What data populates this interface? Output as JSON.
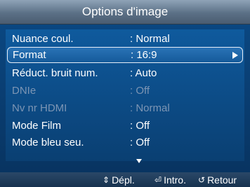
{
  "title": "Options d'image",
  "menu": {
    "items": [
      {
        "label": "Nuance coul.",
        "value": ": Normal",
        "state": "normal"
      },
      {
        "label": "Format",
        "value": ": 16:9",
        "state": "selected"
      },
      {
        "label": "Réduct. bruit num.",
        "value": ": Auto",
        "state": "normal"
      },
      {
        "label": "DNIe",
        "value": ": Off",
        "state": "disabled"
      },
      {
        "label": "Nv nr HDMI",
        "value": ": Normal",
        "state": "disabled"
      },
      {
        "label": "Mode Film",
        "value": ": Off",
        "state": "normal"
      },
      {
        "label": "Mode bleu seu.",
        "value": ": Off",
        "state": "normal"
      }
    ]
  },
  "footer": {
    "move_icon": "⇕",
    "move_label": "Dépl.",
    "enter_icon": "⏎",
    "enter_label": "Intro.",
    "return_icon": "↺",
    "return_label": "Retour"
  },
  "colors": {
    "background": "#0b4a86",
    "selected_row": "#2a73b6",
    "disabled_text": "#7c95b4",
    "footer": "#17324f"
  }
}
